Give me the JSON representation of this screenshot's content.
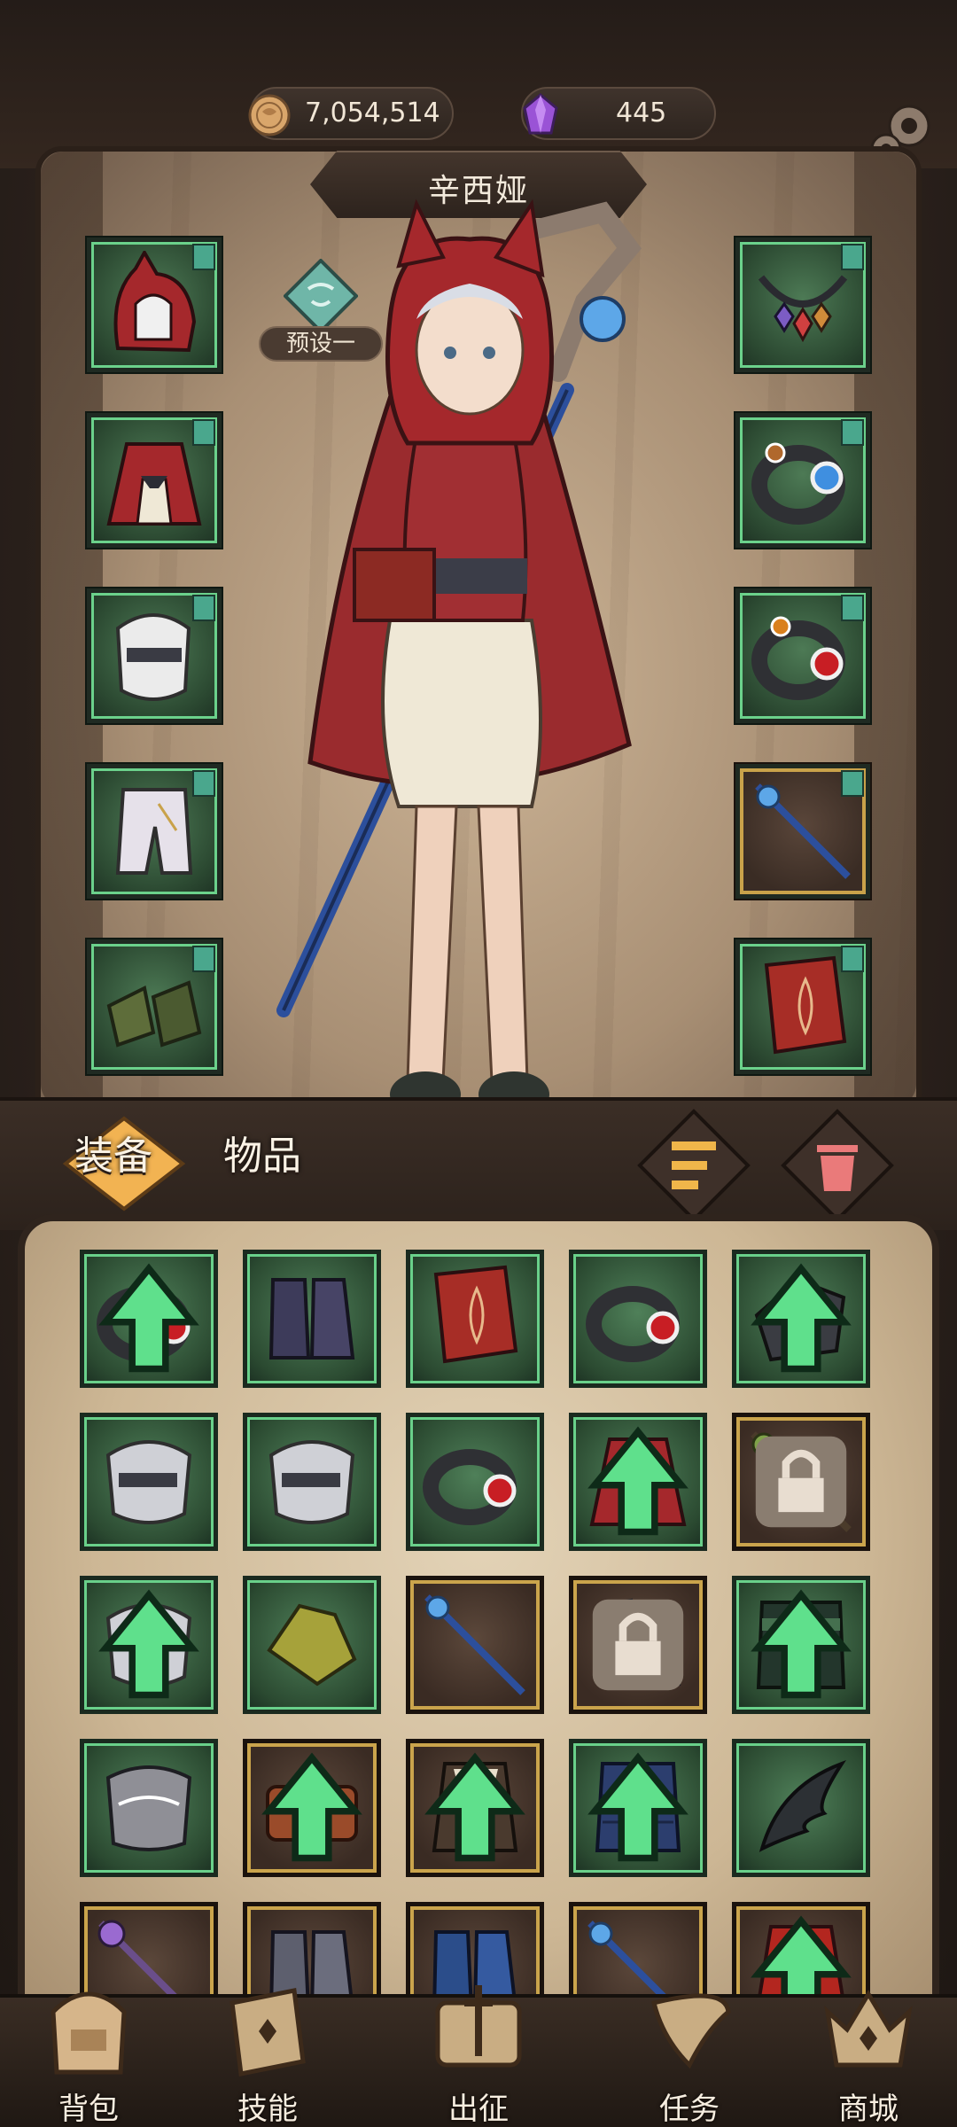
{
  "currency": {
    "coins": "7,054,514",
    "gems": "445"
  },
  "character": {
    "name": "辛西娅",
    "preset_label": "预设一"
  },
  "tabs": {
    "equipment": "装备",
    "items": "物品"
  },
  "nav": {
    "backpack": "背包",
    "skills": "技能",
    "expedition": "出征",
    "tasks": "任务",
    "shop": "商城"
  },
  "colors": {
    "rare_green": "#69d08a",
    "legend_gold": "#caa44c",
    "upgrade_arrow": "#5fe08c",
    "coin": "#d9a66b",
    "gem": "#9a53d6"
  },
  "equipped_left": [
    {
      "icon": "red-hood-icon",
      "rarity": "green"
    },
    {
      "icon": "red-cape-dress-icon",
      "rarity": "green"
    },
    {
      "icon": "white-gloves-icon",
      "rarity": "green"
    },
    {
      "icon": "white-pants-icon",
      "rarity": "green"
    },
    {
      "icon": "green-boots-icon",
      "rarity": "green"
    }
  ],
  "equipped_right": [
    {
      "icon": "gem-necklace-icon",
      "rarity": "green"
    },
    {
      "icon": "blue-gem-ring-icon",
      "rarity": "green"
    },
    {
      "icon": "red-gem-ring-icon",
      "rarity": "green"
    },
    {
      "icon": "blue-staff-icon",
      "rarity": "gold"
    },
    {
      "icon": "red-spellbook-icon",
      "rarity": "green"
    }
  ],
  "inventory": [
    {
      "icon": "red-gem-ring-icon",
      "rarity": "green",
      "upgrade": true,
      "locked": false
    },
    {
      "icon": "purple-boots-icon",
      "rarity": "green",
      "upgrade": false,
      "locked": false
    },
    {
      "icon": "red-spellbook-icon",
      "rarity": "green",
      "upgrade": false,
      "locked": false
    },
    {
      "icon": "red-gem-ring-icon",
      "rarity": "green",
      "upgrade": false,
      "locked": false
    },
    {
      "icon": "dark-helmet-icon",
      "rarity": "green",
      "upgrade": true,
      "locked": false
    },
    {
      "icon": "grey-gloves-icon",
      "rarity": "green",
      "upgrade": false,
      "locked": false
    },
    {
      "icon": "grey-gloves-icon",
      "rarity": "green",
      "upgrade": false,
      "locked": false
    },
    {
      "icon": "red-gem-ring-icon",
      "rarity": "green",
      "upgrade": false,
      "locked": false
    },
    {
      "icon": "red-cape-dress-icon",
      "rarity": "green",
      "upgrade": true,
      "locked": false
    },
    {
      "icon": "gold-staff-icon",
      "rarity": "gold",
      "upgrade": false,
      "locked": true
    },
    {
      "icon": "white-gloves-icon",
      "rarity": "green",
      "upgrade": true,
      "locked": false
    },
    {
      "icon": "yellow-pauldron-icon",
      "rarity": "green",
      "upgrade": false,
      "locked": false
    },
    {
      "icon": "blue-staff-icon",
      "rarity": "gold",
      "upgrade": false,
      "locked": false
    },
    {
      "icon": "armored-boots-icon",
      "rarity": "gold",
      "upgrade": false,
      "locked": true
    },
    {
      "icon": "dark-green-armor-icon",
      "rarity": "green",
      "upgrade": true,
      "locked": false
    },
    {
      "icon": "grey-lace-gloves-icon",
      "rarity": "green",
      "upgrade": false,
      "locked": false
    },
    {
      "icon": "leather-belt-icon",
      "rarity": "gold",
      "upgrade": true,
      "locked": false
    },
    {
      "icon": "pirate-coat-icon",
      "rarity": "gold",
      "upgrade": true,
      "locked": false
    },
    {
      "icon": "blue-quilted-armor-icon",
      "rarity": "green",
      "upgrade": true,
      "locked": false
    },
    {
      "icon": "dark-feather-icon",
      "rarity": "green",
      "upgrade": false,
      "locked": false
    },
    {
      "icon": "purple-staff-icon",
      "rarity": "gold",
      "upgrade": false,
      "locked": false
    },
    {
      "icon": "grey-boots-icon",
      "rarity": "gold",
      "upgrade": false,
      "locked": false
    },
    {
      "icon": "blue-boots-icon",
      "rarity": "gold",
      "upgrade": false,
      "locked": false
    },
    {
      "icon": "blue-staff-icon",
      "rarity": "gold",
      "upgrade": false,
      "locked": false
    },
    {
      "icon": "red-robe-icon",
      "rarity": "gold",
      "upgrade": true,
      "locked": false
    }
  ]
}
